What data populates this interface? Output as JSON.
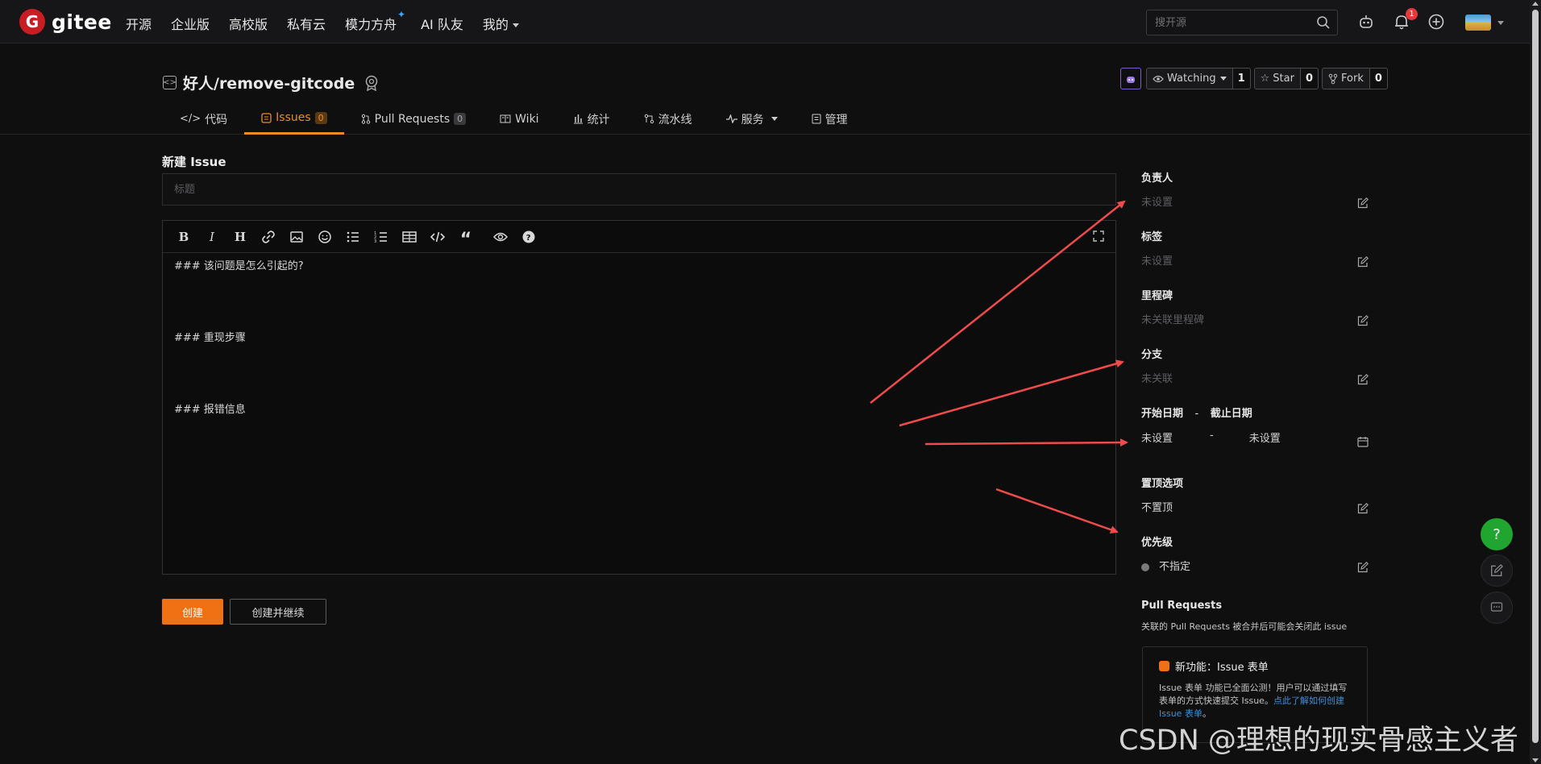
{
  "nav": {
    "logo_text": "gitee",
    "items": [
      "开源",
      "企业版",
      "高校版",
      "私有云",
      "模力方舟",
      "AI 队友",
      "我的"
    ],
    "search_placeholder": "搜开源",
    "notification_count": "1"
  },
  "repo": {
    "name": "好人/remove-gitcode",
    "watching_label": "Watching",
    "watching_count": "1",
    "star_label": "Star",
    "star_count": "0",
    "fork_label": "Fork",
    "fork_count": "0",
    "tabs": [
      {
        "label": "代码"
      },
      {
        "label": "Issues",
        "count": "0"
      },
      {
        "label": "Pull Requests",
        "count": "0"
      },
      {
        "label": "Wiki"
      },
      {
        "label": "统计"
      },
      {
        "label": "流水线"
      },
      {
        "label": "服务"
      },
      {
        "label": "管理"
      }
    ]
  },
  "form": {
    "heading": "新建 Issue",
    "title_placeholder": "标题",
    "body_lines": [
      "### 该问题是怎么引起的?",
      "### 重现步骤",
      "### 报错信息"
    ],
    "create_label": "创建",
    "create_continue_label": "创建并继续"
  },
  "sidebar": {
    "assignee_label": "负责人",
    "assignee_value": "未设置",
    "tags_label": "标签",
    "tags_value": "未设置",
    "milestone_label": "里程碑",
    "milestone_value": "未关联里程碑",
    "branch_label": "分支",
    "branch_value": "未关联",
    "start_date_label": "开始日期",
    "date_separator": "-",
    "due_date_label": "截止日期",
    "start_date_value": "未设置",
    "due_date_value": "未设置",
    "pin_label": "置顶选项",
    "pin_value": "不置顶",
    "priority_label": "优先级",
    "priority_value": "不指定",
    "pr_label": "Pull Requests",
    "pr_desc": "关联的 Pull Requests 被合并后可能会关闭此 issue",
    "new_feature_title": "新功能：Issue 表单",
    "new_feature_text": "Issue 表单 功能已全面公测！用户可以通过填写表单的方式快速提交 Issue。",
    "new_feature_link": "点此了解如何创建 Issue 表单",
    "new_feature_end": "。"
  },
  "colors": {
    "accent": "#f07113",
    "annotation_arrow": "#f04b4b",
    "help_button": "#1fa530"
  },
  "watermark": "CSDN @理想的现实骨感主义者"
}
